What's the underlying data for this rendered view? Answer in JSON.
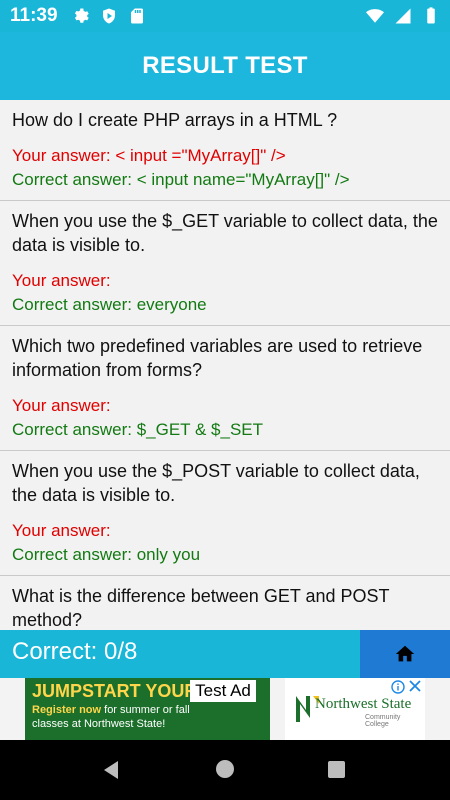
{
  "status": {
    "time": "11:39",
    "icons_left": [
      "gear-icon",
      "shield-icon",
      "sdcard-icon"
    ],
    "icons_right": [
      "wifi-icon",
      "signal-icon",
      "battery-icon"
    ]
  },
  "header": {
    "title": "RESULT TEST"
  },
  "questions": [
    {
      "question": "How do I create PHP arrays in a HTML ?",
      "your_answer": "Your answer: < input =\"MyArray[]\" />",
      "correct_answer": "Correct answer: < input name=\"MyArray[]\" />"
    },
    {
      "question": "When you use the $_GET variable to collect data, the data is visible to.",
      "your_answer": "Your answer:",
      "correct_answer": "Correct answer: everyone"
    },
    {
      "question": "Which two predefined variables are used to retrieve information from forms?",
      "your_answer": "Your answer:",
      "correct_answer": "Correct answer: $_GET & $_SET"
    },
    {
      "question": "When you use the $_POST variable to collect data, the data is visible to.",
      "your_answer": "Your answer:",
      "correct_answer": "Correct answer: only you"
    },
    {
      "question": "What is the difference between GET and POST method?",
      "your_answer": "",
      "correct_answer": ""
    }
  ],
  "footer": {
    "score": "Correct: 0/8",
    "home_icon": "home-icon"
  },
  "ad": {
    "label": "Test Ad",
    "headline": "JUMPSTART YOUR F",
    "body_highlight": "Register now",
    "body_line1": " for summer or fall",
    "body_line2": "classes at Northwest State!",
    "brand_name": "Northwest State",
    "brand_sub": "Community College"
  },
  "colors": {
    "primary": "#1db6dc",
    "home_button": "#1e7ad3",
    "wrong": "#e10000",
    "correct": "#137a13"
  }
}
